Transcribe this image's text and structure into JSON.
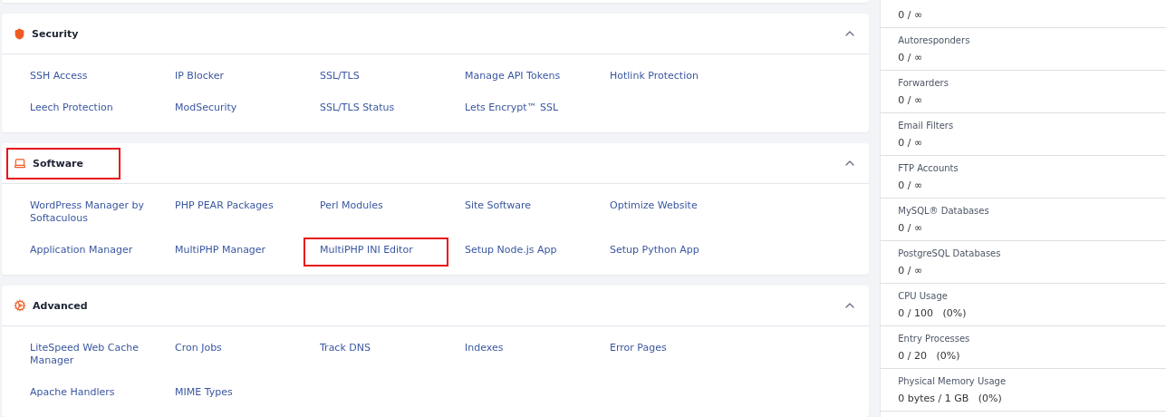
{
  "sections": [
    {
      "kind": "security",
      "title": "Security",
      "expanded": true,
      "highlighted": false,
      "items": [
        {
          "label": "SSH Access",
          "highlighted": false
        },
        {
          "label": "IP Blocker",
          "highlighted": false
        },
        {
          "label": "SSL/TLS",
          "highlighted": false
        },
        {
          "label": "Manage API Tokens",
          "highlighted": false
        },
        {
          "label": "Hotlink Protection",
          "highlighted": false
        },
        {
          "label": "Leech Protection",
          "highlighted": false
        },
        {
          "label": "ModSecurity",
          "highlighted": false
        },
        {
          "label": "SSL/TLS Status",
          "highlighted": false
        },
        {
          "label": "Lets Encrypt™ SSL",
          "highlighted": false
        }
      ]
    },
    {
      "kind": "software",
      "title": "Software",
      "expanded": true,
      "highlighted": true,
      "items": [
        {
          "label": "WordPress Manager by Softaculous",
          "highlighted": false
        },
        {
          "label": "PHP PEAR Packages",
          "highlighted": false
        },
        {
          "label": "Perl Modules",
          "highlighted": false
        },
        {
          "label": "Site Software",
          "highlighted": false
        },
        {
          "label": "Optimize Website",
          "highlighted": false
        },
        {
          "label": "Application Manager",
          "highlighted": false
        },
        {
          "label": "MultiPHP Manager",
          "highlighted": false
        },
        {
          "label": "MultiPHP INI Editor",
          "highlighted": true
        },
        {
          "label": "Setup Node.js App",
          "highlighted": false
        },
        {
          "label": "Setup Python App",
          "highlighted": false
        }
      ]
    },
    {
      "kind": "advanced",
      "title": "Advanced",
      "expanded": true,
      "highlighted": false,
      "items": [
        {
          "label": "LiteSpeed Web Cache Manager",
          "highlighted": false
        },
        {
          "label": "Cron Jobs",
          "highlighted": false
        },
        {
          "label": "Track DNS",
          "highlighted": false
        },
        {
          "label": "Indexes",
          "highlighted": false
        },
        {
          "label": "Error Pages",
          "highlighted": false
        },
        {
          "label": "Apache Handlers",
          "highlighted": false
        },
        {
          "label": "MIME Types",
          "highlighted": false
        }
      ]
    }
  ],
  "stats": [
    {
      "value": "0 / ∞"
    },
    {
      "label": "Autoresponders",
      "value": "0 / ∞"
    },
    {
      "label": "Forwarders",
      "value": "0 / ∞"
    },
    {
      "label": "Email Filters",
      "value": "0 / ∞"
    },
    {
      "label": "FTP Accounts",
      "value": "0 / ∞"
    },
    {
      "label": "MySQL® Databases",
      "value": "0 / ∞"
    },
    {
      "label": "PostgreSQL Databases",
      "value": "0 / ∞"
    },
    {
      "label": "CPU Usage",
      "value": "0 / 100",
      "percent": "(0%)"
    },
    {
      "label": "Entry Processes",
      "value": "0 / 20",
      "percent": "(0%)"
    },
    {
      "label": "Physical Memory Usage",
      "value": "0 bytes / 1 GB",
      "percent": "(0%)"
    }
  ]
}
